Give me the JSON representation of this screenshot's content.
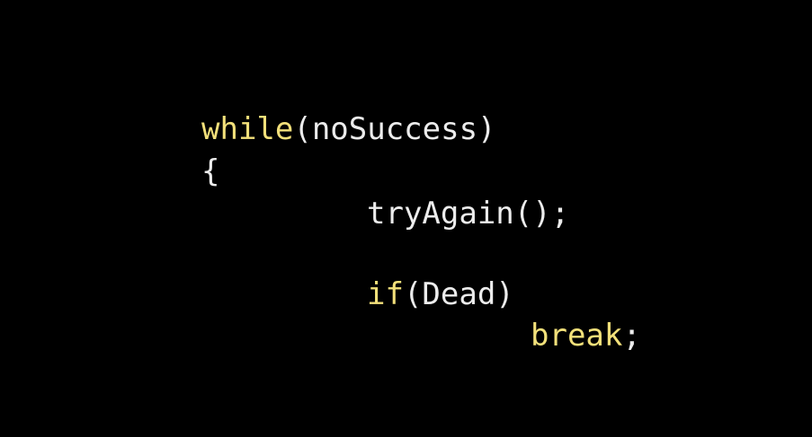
{
  "code": {
    "line1": {
      "keyword": "while",
      "rest": "(noSuccess)"
    },
    "line2": {
      "text": "{"
    },
    "line3": {
      "text": "tryAgain();"
    },
    "line4": {
      "keyword": "if",
      "rest": "(Dead)"
    },
    "line5": {
      "keyword": "break",
      "rest": ";"
    }
  },
  "colors": {
    "background": "#000000",
    "keyword": "#f2e07a",
    "text": "#ececec"
  }
}
